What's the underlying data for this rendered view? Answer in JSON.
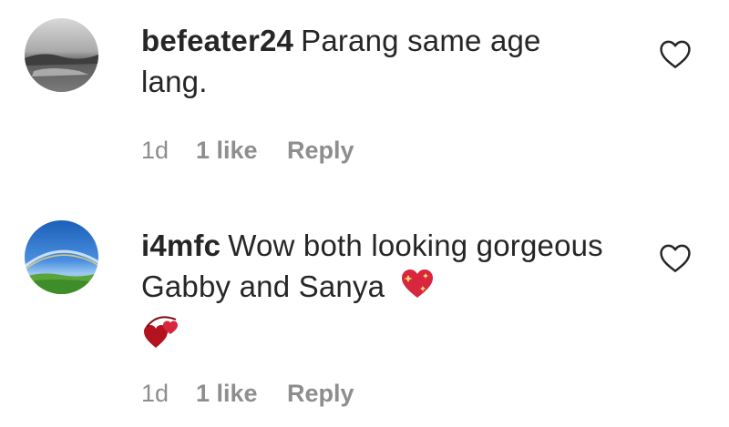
{
  "comments": [
    {
      "username": "befeater24",
      "text": "Parang same age lang.",
      "time": "1d",
      "likes": "1 like",
      "reply": "Reply",
      "avatar_icon": "landscape-avatar",
      "like_icon": "heart-outline-icon"
    },
    {
      "username": "i4mfc",
      "text": "Wow both looking gorgeous Gabby and Sanya",
      "emojis": [
        "sparkling-heart",
        "revolving-hearts"
      ],
      "time": "1d",
      "likes": "1 like",
      "reply": "Reply",
      "avatar_icon": "sky-rainbow-avatar",
      "like_icon": "heart-outline-icon"
    }
  ],
  "colors": {
    "text": "#262626",
    "meta": "#8e8e8e",
    "heart_stroke": "#262626",
    "emoji_red": "#d7263d"
  }
}
